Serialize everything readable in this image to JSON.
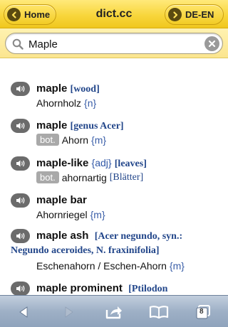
{
  "header": {
    "home_label": "Home",
    "title": "dict.cc",
    "lang_label": "DE-EN"
  },
  "search": {
    "value": "Maple",
    "placeholder": ""
  },
  "results": [
    {
      "term": "maple",
      "tag": "[wood]",
      "badge": "",
      "translation": "Ahornholz",
      "gender": "{n}",
      "note": ""
    },
    {
      "term": "maple",
      "tag": "[genus Acer]",
      "badge": "bot.",
      "translation": "Ahorn",
      "gender": "{m}",
      "note": ""
    },
    {
      "term": "maple-like",
      "tag": "{adj}",
      "tag2": "[leaves]",
      "badge": "bot.",
      "translation": "ahornartig",
      "gender": "",
      "note": "[Blätter]"
    },
    {
      "term": "maple bar",
      "tag": "",
      "badge": "",
      "translation": "Ahornriegel",
      "gender": "{m}",
      "note": ""
    },
    {
      "term": "maple ash",
      "tag": "[Acer negundo, syn.:",
      "tag_cont": "Negundo aceroides, N. fraxinifolia]",
      "badge": "",
      "translation": "Eschenahorn / Eschen-Ahorn",
      "gender": "{m}",
      "note": ""
    },
    {
      "term": "maple prominent",
      "tag": "[Ptilodon",
      "badge": "",
      "translation": "",
      "gender": "",
      "note": ""
    }
  ],
  "toolbar": {
    "tabs_count": "8"
  },
  "colors": {
    "header_yellow": "#f8d63c",
    "tag_blue": "#22468a",
    "toolbar_blue": "#9eb0c6"
  }
}
